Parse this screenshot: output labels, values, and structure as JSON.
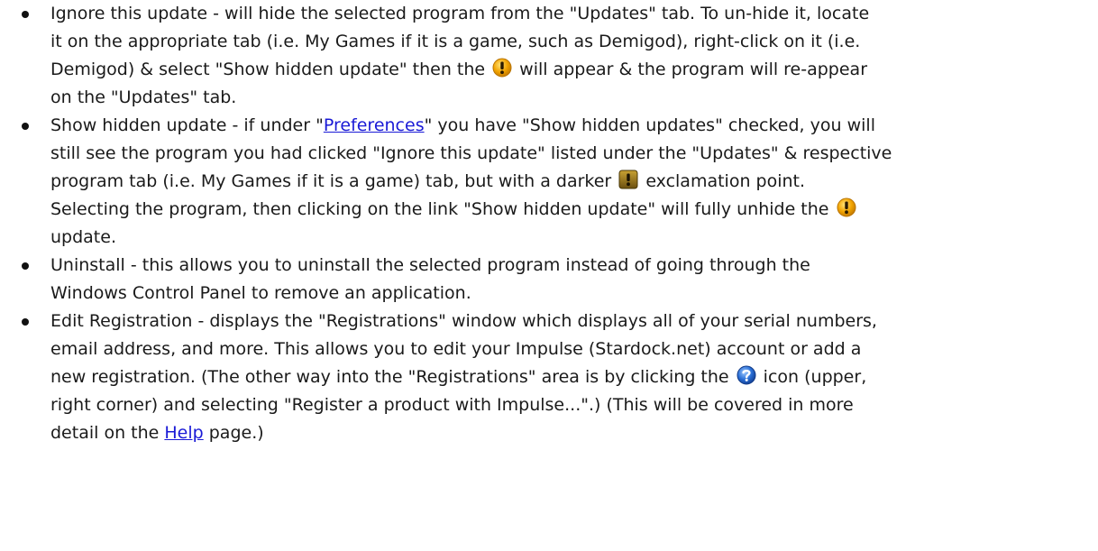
{
  "items": [
    {
      "lines": [
        "Ignore this update - will hide the selected program from the \"Updates\" tab. To un-hide it, locate",
        "it on the appropriate tab (i.e. My Games if it is a game, such as Demigod), right-click on it (i.e.",
        {
          "before": "Demigod) & select \"Show hidden update\" then the ",
          "after": " will appear & the program will re-appear"
        },
        "on the \"Updates\" tab."
      ]
    },
    {
      "line1_before": "Show hidden update - if under \"",
      "line1_link": "Preferences",
      "line1_after": "\" you have \"Show hidden updates\" checked, you will",
      "line2": "still see the program you had clicked \"Ignore this update\" listed under the \"Updates\" & respective",
      "line3_before": "program tab (i.e. My Games if it is a game) tab, but with a darker ",
      "line3_after": " exclamation point.",
      "line4_before": "Selecting the program, then clicking on the link \"Show hidden update\" will fully unhide the ",
      "line5": "update."
    },
    {
      "line1": "Uninstall - this allows you to uninstall the selected program instead of going through the",
      "line2": "Windows Control Panel to remove an application."
    },
    {
      "line1": "Edit Registration - displays the \"Registrations\" window which displays all of your serial numbers,",
      "line2": "email address, and more. This allows you to edit your Impulse (Stardock.net) account or add a",
      "line3_before": "new registration. (The other way into the \"Registrations\" area is by clicking the ",
      "line3_after": " icon (upper,",
      "line4": "right corner) and selecting \"Register a product with Impulse...\".) (This will be covered in more",
      "line5_before": "detail on the ",
      "line5_link": "Help",
      "line5_after": " page.)"
    }
  ],
  "icons": {
    "update": "warning-exclamation-icon",
    "hidden_update": "dark-exclamation-icon",
    "help": "help-question-icon"
  },
  "colors": {
    "update_orange": "#f2a400",
    "hidden_dark": "#8a6a10",
    "help_blue": "#2a6fd6",
    "link": "#1a1ad6"
  }
}
